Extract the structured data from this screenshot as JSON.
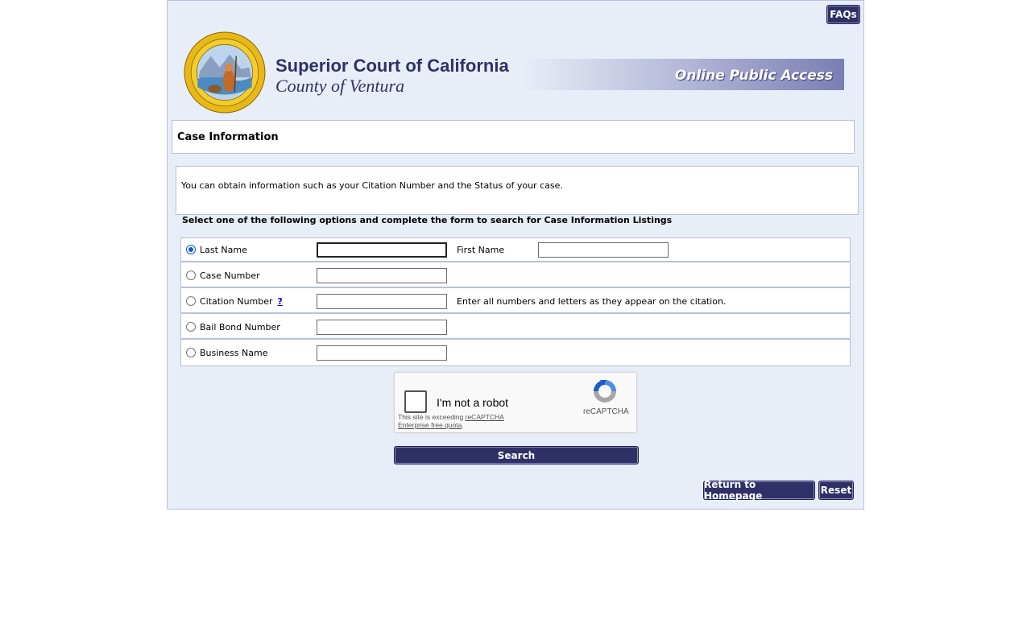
{
  "header": {
    "faq_label": "FAQs",
    "court_title": "Superior Court of California",
    "county_title": "County of Ventura",
    "banner_text": "Online Public Access"
  },
  "section": {
    "title": "Case Information",
    "info_text": "You can obtain information such as your Citation Number and the Status of your case.",
    "instruction": "Select one of the following options and complete the form to search for Case Information Listings"
  },
  "search_options": [
    {
      "label": "Last Name",
      "selected": true,
      "value": "",
      "extra_label": "First Name",
      "extra_value": ""
    },
    {
      "label": "Case Number",
      "selected": false,
      "value": ""
    },
    {
      "label": "Citation Number",
      "selected": false,
      "value": "",
      "help_link": "?",
      "hint": "Enter all numbers and letters as they appear on the citation."
    },
    {
      "label": "Bail Bond Number",
      "selected": false,
      "value": ""
    },
    {
      "label": "Business Name",
      "selected": false,
      "value": ""
    }
  ],
  "captcha": {
    "label": "I'm not a robot",
    "brand": "reCAPTCHA",
    "note_prefix": "This site is exceeding ",
    "note_link": "reCAPTCHA Enterprise free quota",
    "note_suffix": "."
  },
  "actions": {
    "search_label": "Search",
    "return_label": "Return to Homepage",
    "reset_label": "Reset"
  },
  "colors": {
    "button_bg": "#2f3166",
    "page_bg": "#e8eef7",
    "border": "#b8c0dd"
  }
}
